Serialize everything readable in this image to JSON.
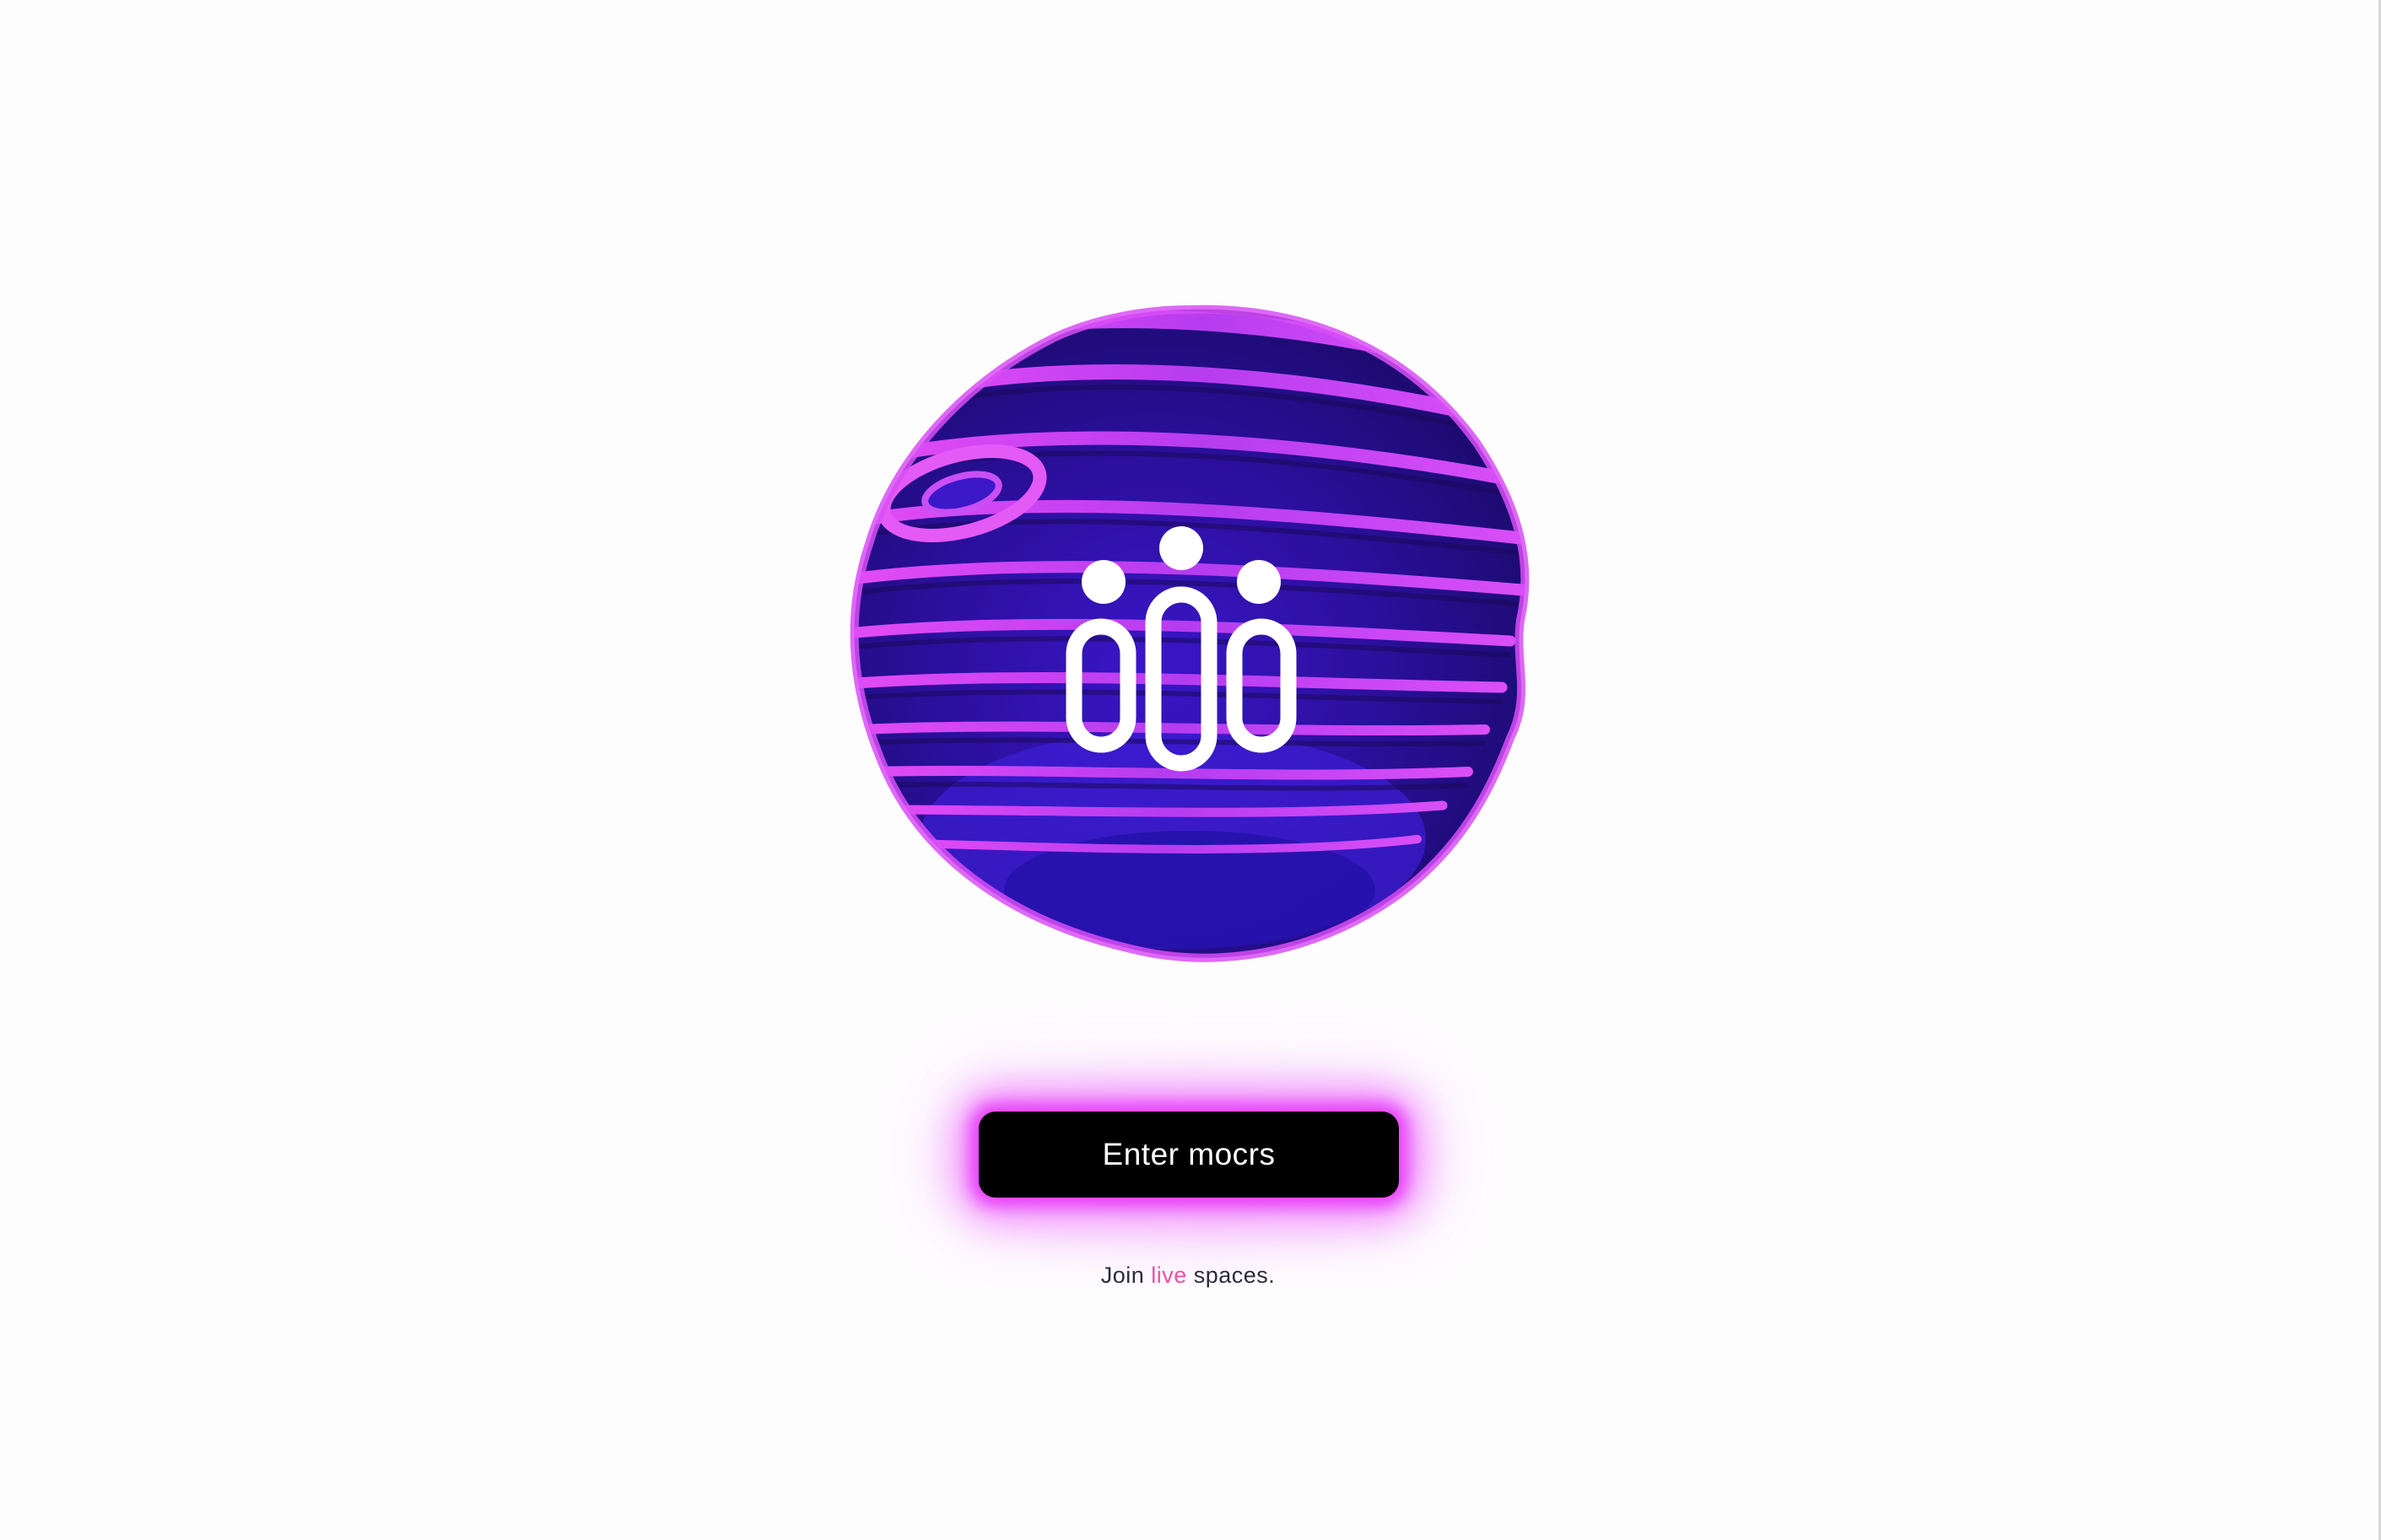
{
  "app": {
    "logo_icon": "mocrs-people-logo-icon"
  },
  "hero": {
    "orb_icon": "purple-wavy-sphere-graphic"
  },
  "cta": {
    "enter_label": "Enter mocrs",
    "glow_color": "#e83cfa"
  },
  "tagline": {
    "prefix": "Join ",
    "accent": "live",
    "suffix": " spaces.",
    "accent_color": "#ee4fa6"
  }
}
